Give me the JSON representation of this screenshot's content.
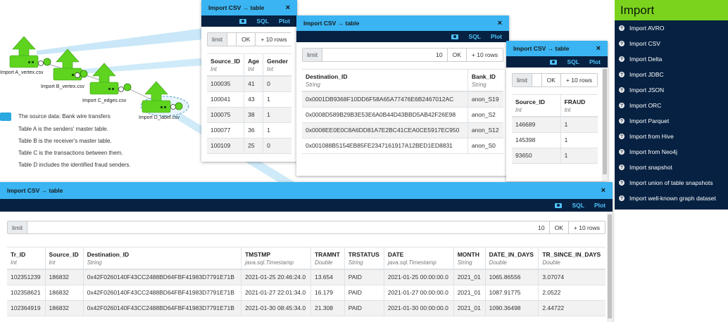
{
  "graph": {
    "nodes": [
      {
        "label": "Import A_vertex.csv"
      },
      {
        "label": "Import B_vertex.csv"
      },
      {
        "label": "Import C_edges.csv"
      },
      {
        "label": "Import D_label.csv"
      }
    ],
    "legend": [
      "The source data: Bank wire transfers",
      "Table A is the senders' master table.",
      "Table B is the receiver's master table.",
      "Table C is the transactions between them.",
      "Table D includes the identified fraud senders."
    ]
  },
  "colors": {
    "dialog_title": "#3ab4f2",
    "toolbar": "#062142",
    "toolbar_text": "#4fc3f7",
    "menu_header": "#7cd31e",
    "menu_bg": "#062142",
    "node_green": "#5ed41f"
  },
  "icons": {
    "camera": "camera-icon",
    "close": "close-icon",
    "help": "help-circle-icon",
    "upload": "upload-arrow-icon"
  },
  "dialogs": {
    "a": {
      "title": "Import CSV → table",
      "close": "×",
      "toolbar": {
        "sql": "SQL",
        "plot": "Plot"
      },
      "limit_label": "limit",
      "limit_value": "",
      "ok": "OK",
      "more_rows": "+ 10 rows",
      "columns": [
        {
          "name": "Source_ID",
          "type": "Int"
        },
        {
          "name": "Age",
          "type": "Int"
        },
        {
          "name": "Gender",
          "type": "Int"
        }
      ],
      "rows": [
        [
          "100035",
          "41",
          "0"
        ],
        [
          "100041",
          "43",
          "1"
        ],
        [
          "100075",
          "38",
          "1"
        ],
        [
          "100077",
          "36",
          "1"
        ],
        [
          "100109",
          "25",
          "0"
        ]
      ]
    },
    "b": {
      "title": "Import CSV → table",
      "close": "×",
      "toolbar": {
        "sql": "SQL",
        "plot": "Plot"
      },
      "limit_label": "limit",
      "limit_value": "10",
      "ok": "OK",
      "more_rows": "+ 10 rows",
      "columns": [
        {
          "name": "Destination_ID",
          "type": "String"
        },
        {
          "name": "Bank_ID",
          "type": "String"
        }
      ],
      "rows": [
        [
          "0x0001DB9368F10DD6F58A65A77476E6B2467012AC",
          "anon_S19"
        ],
        [
          "0x0008D589B29B3E53E6A0B44D43BBD5AB42F26E98",
          "anon_S2"
        ],
        [
          "0x0008EE0E0C8A6DD81A7E2BC41CEA0CE5917EC950",
          "anon_S12"
        ],
        [
          "0x001088B5154EB85FE2347161917A12BED1ED8831",
          "anon_S0"
        ]
      ]
    },
    "c": {
      "title": "Import CSV → table",
      "close": "×",
      "toolbar": {
        "sql": "SQL",
        "plot": "Plot"
      },
      "limit_label": "limit",
      "limit_value": "",
      "ok": "OK",
      "more_rows": "+ 10 rows",
      "columns": [
        {
          "name": "Source_ID",
          "type": "Int"
        },
        {
          "name": "FRAUD",
          "type": "Int"
        }
      ],
      "rows": [
        [
          "146689",
          "1"
        ],
        [
          "145398",
          "1"
        ],
        [
          "93650",
          "1"
        ]
      ]
    },
    "d": {
      "title": "Import CSV → table",
      "close": "×",
      "toolbar": {
        "sql": "SQL",
        "plot": "Plot"
      },
      "limit_label": "limit",
      "limit_value": "10",
      "ok": "OK",
      "more_rows": "+ 10 rows",
      "columns": [
        {
          "name": "Tr_ID",
          "type": "Int"
        },
        {
          "name": "Source_ID",
          "type": "Int"
        },
        {
          "name": "Destination_ID",
          "type": "String"
        },
        {
          "name": "TMSTMP",
          "type": "java.sql.Timestamp"
        },
        {
          "name": "TRAMNT",
          "type": "Double"
        },
        {
          "name": "TRSTATUS",
          "type": "String"
        },
        {
          "name": "DATE",
          "type": "java.sql.Timestamp"
        },
        {
          "name": "MONTH",
          "type": "String"
        },
        {
          "name": "DATE_IN_DAYS",
          "type": "Double"
        },
        {
          "name": "TR_SINCE_IN_DAYS",
          "type": "Double"
        }
      ],
      "rows": [
        [
          "102351239",
          "186832",
          "0x42F0260140F43CC2488BD64FBF41983D7791E71B",
          "2021-01-25 20:46:24.0",
          "13.654",
          "PAID",
          "2021-01-25 00:00:00.0",
          "2021_01",
          "1065.86556",
          "3.07074"
        ],
        [
          "102358621",
          "186832",
          "0x42F0260140F43CC2488BD64FBF41983D7791E71B",
          "2021-01-27 22:01:34.0",
          "16.179",
          "PAID",
          "2021-01-27 00:00:00.0",
          "2021_01",
          "1087.91775",
          "2.0522"
        ],
        [
          "102364919",
          "186832",
          "0x42F0260140F43CC2488BD64FBF41983D7791E71B",
          "2021-01-30 08:45:34.0",
          "21.308",
          "PAID",
          "2021-01-30 00:00:00.0",
          "2021_01",
          "1090.36498",
          "2.44722"
        ]
      ]
    }
  },
  "import_menu": {
    "header": "Import",
    "items": [
      "Import AVRO",
      "Import CSV",
      "Import Delta",
      "Import JDBC",
      "Import JSON",
      "Import ORC",
      "Import Parquet",
      "Import from Hive",
      "Import from Neo4j",
      "Import snapshot",
      "Import union of table snapshots",
      "Import well-known graph dataset"
    ]
  }
}
